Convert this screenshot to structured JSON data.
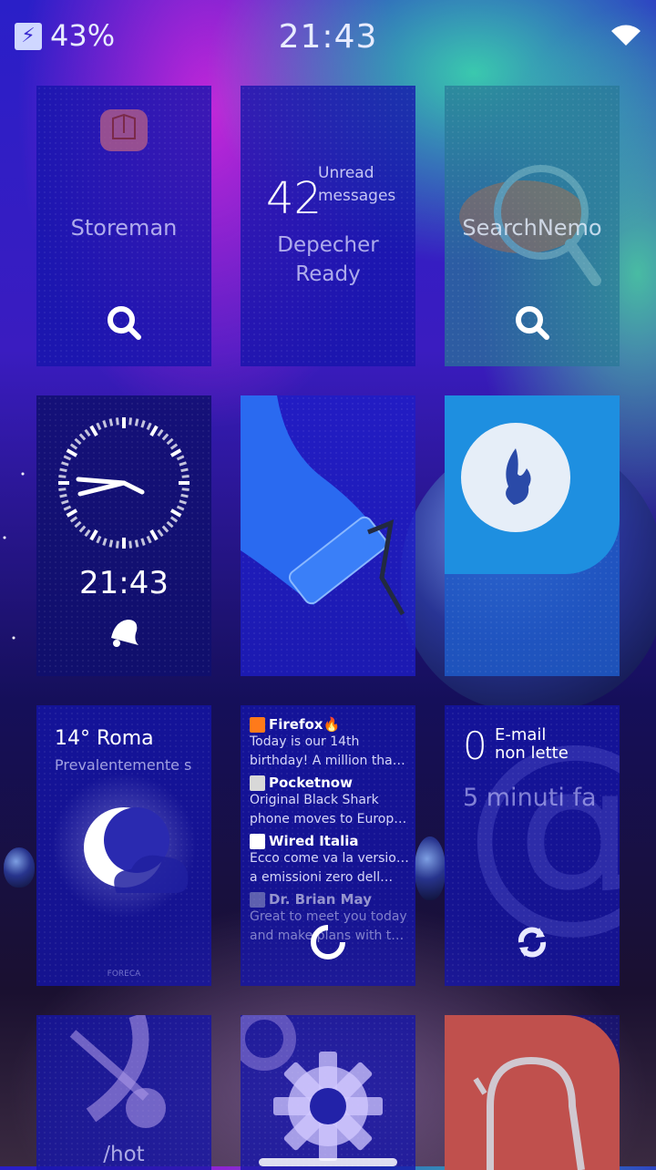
{
  "status_bar": {
    "battery_percent": "43%",
    "time": "21:43",
    "battery_icon": "charging-bolt-icon",
    "wifi_icon": "wifi-icon"
  },
  "tiles": {
    "storeman": {
      "label": "Storeman",
      "icon": "storeman-box-icon",
      "action_icon": "search-icon"
    },
    "depecher": {
      "count": "42",
      "count_label_1": "Unread",
      "count_label_2": "messages",
      "status_line_1": "Depecher",
      "status_line_2": "Ready"
    },
    "searchnemo": {
      "label": "SearchNemo",
      "action_icon": "search-icon"
    },
    "clock": {
      "time": "21:43",
      "alarm_icon": "bell-icon"
    },
    "themepainter": {
      "icon": "paint-roller-icon"
    },
    "app_blue": {
      "icon": "flame-logo-icon"
    },
    "weather": {
      "location": "14° Roma",
      "condition": "Prevalentemente s",
      "provider": "FORECA",
      "icon": "moon-cloud-icon"
    },
    "feeds": {
      "items": [
        {
          "source": "Firefox🔥",
          "text_1": "Today is our 14th",
          "text_2": "birthday! A million than…",
          "icon_color": "#ff7a1a"
        },
        {
          "source": "Pocketnow",
          "text_1": "Original Black Shark",
          "text_2": "phone moves to Europ…",
          "icon_color": "#d8d8d8"
        },
        {
          "source": "Wired Italia",
          "text_1": "Ecco come va la versione",
          "text_2": "a emissioni zero dell…",
          "icon_color": "#ffffff"
        },
        {
          "source": "Dr. Brian May",
          "text_1": "Great to meet you today",
          "text_2": "and make plans with th…",
          "icon_color": "#9aa0c8"
        }
      ],
      "refresh_icon": "refresh-icon"
    },
    "email": {
      "count": "0",
      "label_1": "E-mail",
      "label_2": "non lette",
      "last_sync": "5 minuti fa",
      "refresh_icon": "refresh-icon"
    },
    "hot": {
      "label": "/hot"
    },
    "settings": {
      "icon": "gear-icon"
    },
    "red_app": {
      "icon": "magnet-icon",
      "color": "#c0504d"
    }
  }
}
